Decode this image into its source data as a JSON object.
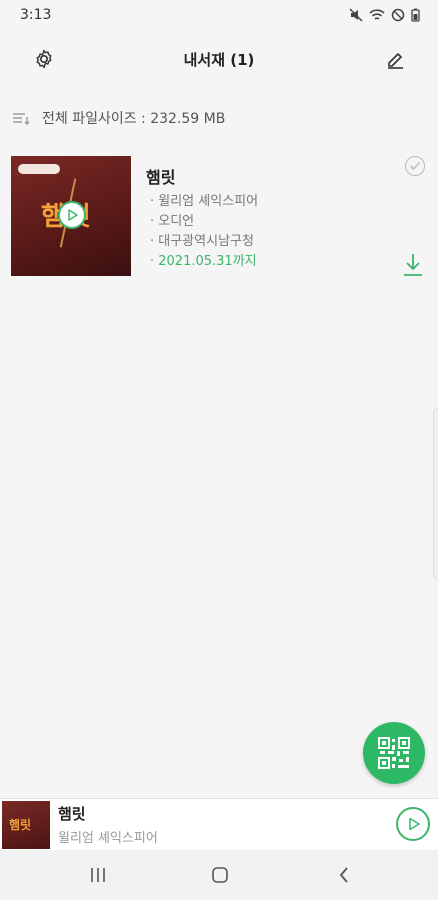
{
  "status_bar": {
    "time": "3:13"
  },
  "header": {
    "title": "내서재 (1)"
  },
  "summary": {
    "file_size_label": "전체 파일사이즈 : 232.59 MB"
  },
  "books": [
    {
      "cover_text": "햄릿",
      "title": "햄릿",
      "author": "· 윌리엄 셰익스피어",
      "format": "· 오디언",
      "library": "· 대구광역시남구청",
      "due": "· 2021.05.31까지"
    }
  ],
  "mini_player": {
    "cover_text": "햄릿",
    "title": "햄릿",
    "author": "윌리엄 셰익스피어"
  },
  "colors": {
    "accent": "#3cb56a",
    "fab": "#2db866"
  },
  "icons": [
    "gear-icon",
    "pencil-icon",
    "sort-icon",
    "play-icon",
    "check-icon",
    "download-icon",
    "qr-code-icon"
  ]
}
